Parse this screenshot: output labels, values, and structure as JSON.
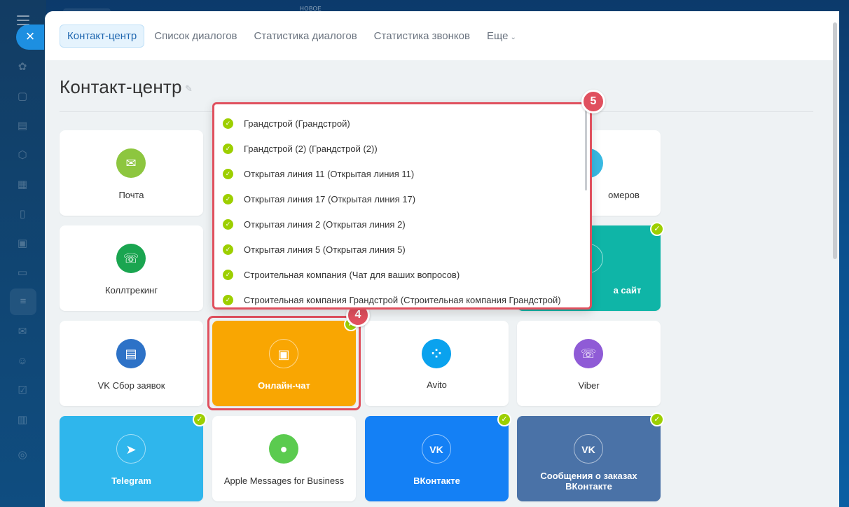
{
  "topbar": {
    "new_label": "НОВОЕ"
  },
  "close_label": "×",
  "tabs": [
    {
      "label": "Контакт-центр"
    },
    {
      "label": "Список диалогов"
    },
    {
      "label": "Статистика диалогов"
    },
    {
      "label": "Статистика звонков"
    },
    {
      "label": "Еще",
      "chevron": "chevron-down-icon"
    }
  ],
  "page_title": "Контакт-центр",
  "tiles": [
    {
      "label": "Почта",
      "icon": "mail-icon",
      "color": "#8dc63f"
    },
    {
      "label": "...номеров",
      "visible_label": "омеров",
      "icon": "numbers-icon",
      "color": "#39b9e2"
    },
    {
      "label": "Коллтрекинг",
      "icon": "calltracking-icon",
      "color": "#1aa550"
    },
    {
      "label": "...на сайт",
      "visible_label": "а сайт",
      "icon": "widget-icon",
      "color": "#0fb5a7"
    },
    {
      "label": "VK Сбор заявок",
      "icon": "vk-leads-icon",
      "color": "#2d72c7"
    },
    {
      "label": "Онлайн-чат",
      "icon": "chat-icon",
      "color": "#f9a602"
    },
    {
      "label": "Avito",
      "icon": "avito-icon",
      "color": "#0aa2ee"
    },
    {
      "label": "Viber",
      "icon": "viber-icon",
      "color": "#8f5bd6"
    },
    {
      "label": "Telegram",
      "icon": "telegram-icon",
      "color": "#2fb6ec"
    },
    {
      "label": "Apple Messages for Business",
      "icon": "apple-messages-icon",
      "color": "#5bcb4f"
    },
    {
      "label": "ВКонтакте",
      "icon": "vk-icon",
      "color": "#1480f5"
    },
    {
      "label": "Сообщения о заказах ВКонтакте",
      "icon": "vk-orders-icon",
      "color": "#4a72a7"
    }
  ],
  "dropdown": {
    "items": [
      "Грандстрой (Грандстрой)",
      "Грандстрой (2) (Грандстрой (2))",
      "Открытая линия 11 (Открытая линия 11)",
      "Открытая линия 17 (Открытая линия 17)",
      "Открытая линия 2 (Открытая линия 2)",
      "Открытая линия 5 (Открытая линия 5)",
      "Строительная компания (Чат для ваших вопросов)",
      "Строительная компания Грандстрой (Строительная компания Грандстрой)"
    ]
  },
  "badges": {
    "dropdown": "5",
    "tile": "4"
  },
  "colors": {
    "accent": "#2067b0",
    "check": "#9dcf00",
    "highlight": "#e0505e"
  }
}
